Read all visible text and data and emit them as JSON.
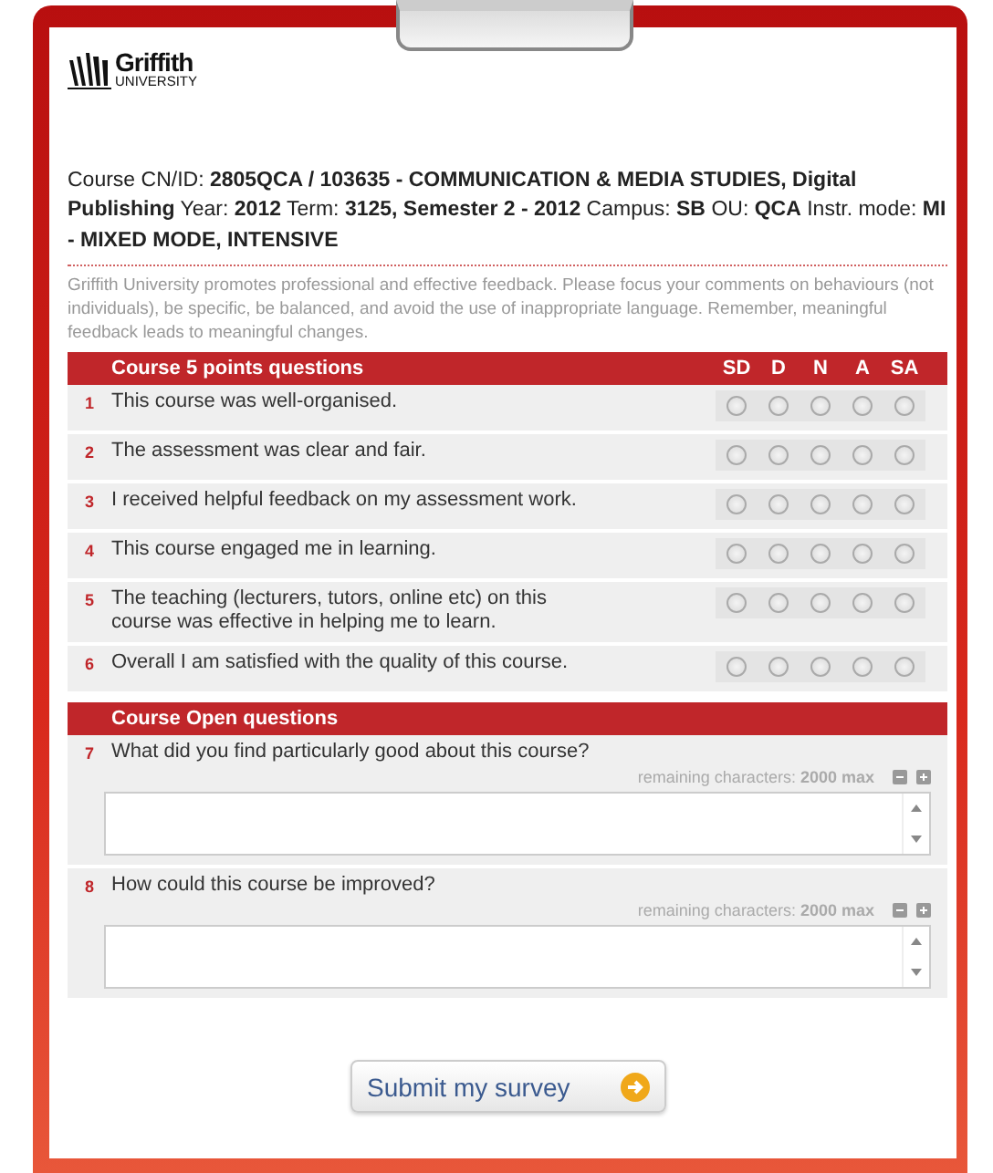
{
  "logo": {
    "name": "Griffith",
    "subtitle": "UNIVERSITY"
  },
  "course_info": "Course CN/ID: **2805QCA / 103635 - COMMUNICATION & MEDIA STUDIES, Digital Publishing** Year: **2012** Term: **3125, Semester 2 - 2012** Campus: **SB** OU: **QCA** Instr. mode: **MI - MIXED MODE, INTENSIVE**",
  "notice": "Griffith University promotes professional and effective feedback. Please focus your comments on behaviours (not individuals), be specific, be balanced, and avoid the use of inappropriate language. Remember, meaningful feedback leads to meaningful changes.",
  "rating_section": {
    "title": "Course 5 points questions",
    "scale": [
      "SD",
      "D",
      "N",
      "A",
      "SA"
    ],
    "questions": [
      {
        "number": "1",
        "text": "This course was well-organised.",
        "options": [
          {
            "selected": false
          },
          {
            "selected": false
          },
          {
            "selected": false
          },
          {
            "selected": false
          },
          {
            "selected": false
          }
        ]
      },
      {
        "number": "2",
        "text": "The assessment was clear and fair.",
        "options": [
          {
            "selected": false
          },
          {
            "selected": false
          },
          {
            "selected": false
          },
          {
            "selected": false
          },
          {
            "selected": false
          }
        ]
      },
      {
        "number": "3",
        "text": "I received helpful feedback on my assessment work.",
        "options": [
          {
            "selected": false
          },
          {
            "selected": false
          },
          {
            "selected": false
          },
          {
            "selected": false
          },
          {
            "selected": false
          }
        ]
      },
      {
        "number": "4",
        "text": "This course engaged me in learning.",
        "options": [
          {
            "selected": false
          },
          {
            "selected": false
          },
          {
            "selected": false
          },
          {
            "selected": false
          },
          {
            "selected": false
          }
        ]
      },
      {
        "number": "5",
        "text": "The teaching (lecturers, tutors, online etc) on this course was effective in helping me to learn.",
        "options": [
          {
            "selected": false
          },
          {
            "selected": false
          },
          {
            "selected": false
          },
          {
            "selected": false
          },
          {
            "selected": false
          }
        ]
      },
      {
        "number": "6",
        "text": "Overall I am satisfied with the quality of this course.",
        "options": [
          {
            "selected": false
          },
          {
            "selected": false
          },
          {
            "selected": false
          },
          {
            "selected": false
          },
          {
            "selected": false
          }
        ]
      }
    ]
  },
  "open_section": {
    "title": "Course Open questions",
    "questions": [
      {
        "number": "7",
        "text": "What did you find particularly good about this course?",
        "remaining_label": "remaining characters:",
        "remaining_value": "2000 max"
      },
      {
        "number": "8",
        "text": "How could this course be improved?",
        "remaining_label": "remaining characters:",
        "remaining_value": "2000 max"
      }
    ]
  },
  "submit_button": "Submit my survey"
}
